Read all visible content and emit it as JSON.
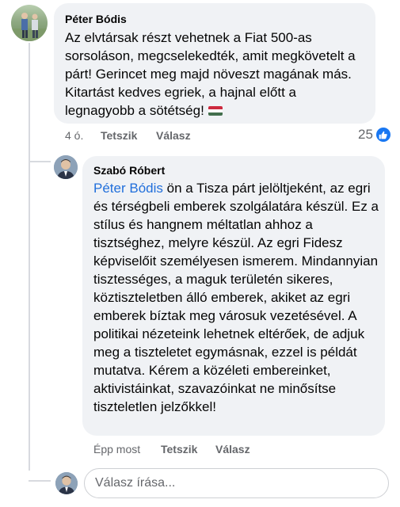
{
  "comments": [
    {
      "author": "Péter Bódis",
      "text": "Az elvtársak részt vehetnek a Fiat 500-as sorsoláson, megcselekedték, amit megkövetelt a párt! Gerincet meg majd növeszt magának más. Kitartást kedves egriek, a hajnal előtt a legnagyobb a sötétség!",
      "flag_icon": "hungary-flag-icon",
      "time": "4 ó.",
      "like_label": "Tetszik",
      "reply_label": "Válasz",
      "reaction_count": "25",
      "reaction_icon": "like-icon",
      "colors": {
        "reaction": "#1877f2"
      }
    },
    {
      "author": "Szabó Róbert",
      "mention": "Péter Bódis",
      "text": " ön a Tisza párt jelöltjeként, az egri és térségbeli emberek szolgálatára készül. Ez a stílus és hangnem méltatlan ahhoz a tisztséghez, melyre készül. Az egri Fidesz képviselőit személyesen ismerem. Mindannyian tisztességes, a maguk területén sikeres, köztiszteletben álló emberek, akiket az egri emberek bíztak meg városuk vezetésével. A politikai nézeteink lehetnek eltérőek, de adjuk meg a tiszteletet egymásnak, ezzel is példát mutatva. Kérem a közéleti embereinket, aktivistáinkat, szavazóinkat ne minősítse tiszteletlen jelzőkkel!",
      "time": "Épp most",
      "like_label": "Tetszik",
      "reply_label": "Válasz",
      "colors": {
        "mention": "#216fdb"
      }
    }
  ],
  "reply_input": {
    "placeholder": "Válasz írása..."
  }
}
